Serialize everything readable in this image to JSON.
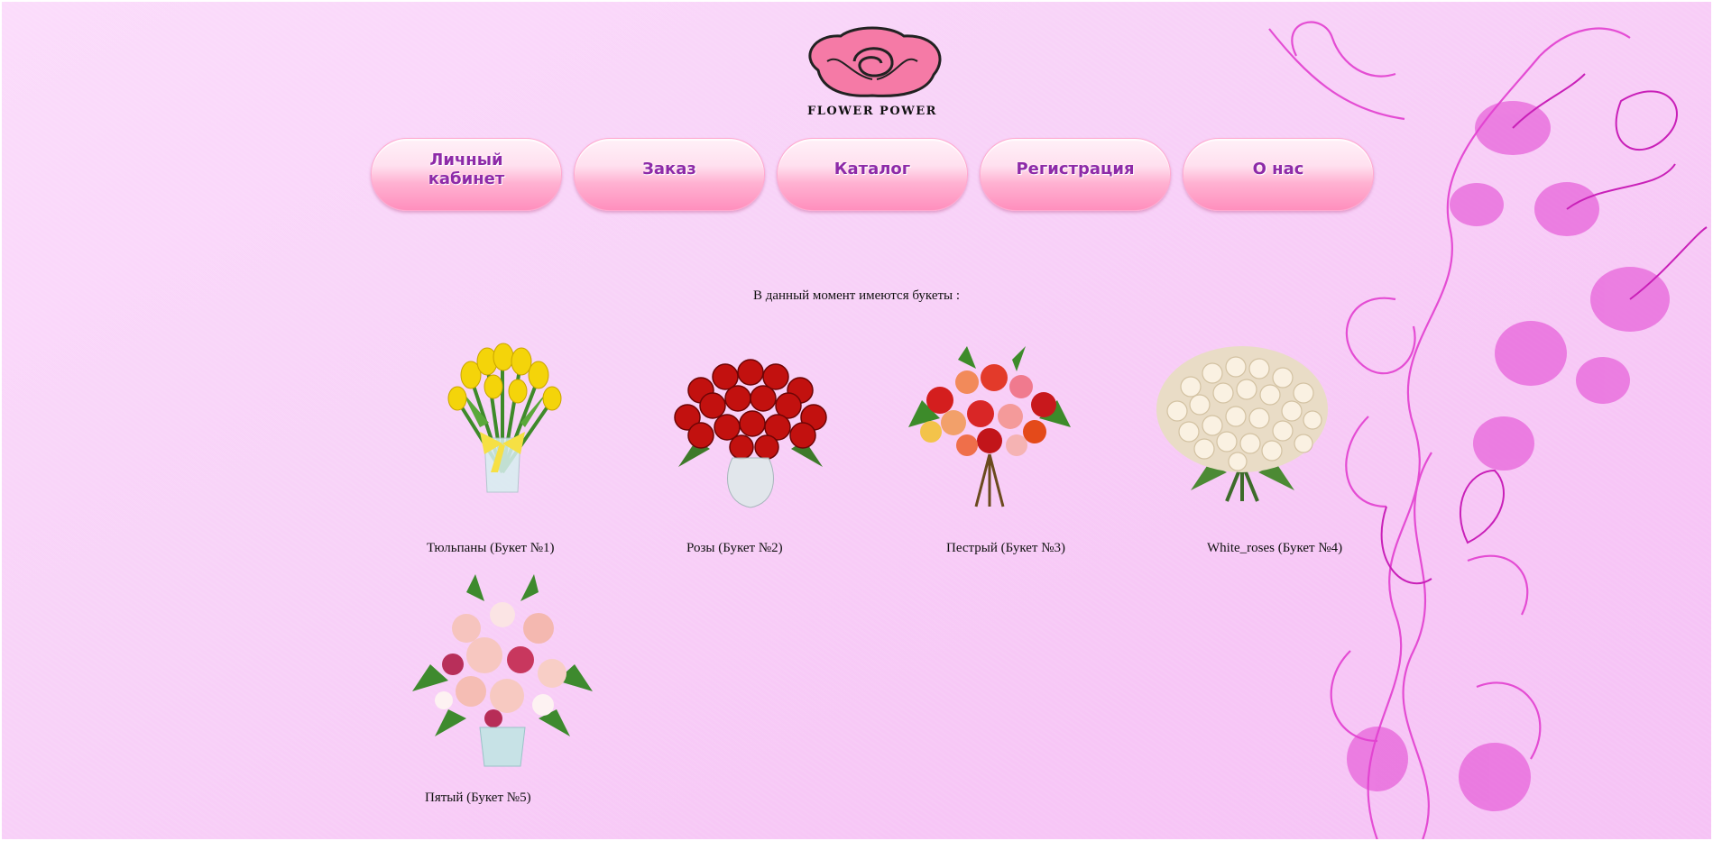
{
  "logo": {
    "text": "FLOWER POWER"
  },
  "nav": [
    {
      "label_line1": "Личный",
      "label_line2": "кабинет"
    },
    {
      "label_line1": "Заказ",
      "label_line2": ""
    },
    {
      "label_line1": "Каталог",
      "label_line2": ""
    },
    {
      "label_line1": "Регистрация",
      "label_line2": ""
    },
    {
      "label_line1": "О нас",
      "label_line2": ""
    }
  ],
  "intro": "В данный момент имеются букеты :",
  "bouquets": [
    {
      "caption": "Тюльпаны (Букет №1)",
      "icon": "yellow-tulip-bouquet"
    },
    {
      "caption": "Розы (Букет №2)",
      "icon": "red-rose-bouquet"
    },
    {
      "caption": "Пестрый (Букет №3)",
      "icon": "mixed-bouquet"
    },
    {
      "caption": "White_roses (Букет №4)",
      "icon": "white-rose-bouquet"
    },
    {
      "caption": "Пятый (Букет №5)",
      "icon": "pink-rose-bouquet"
    }
  ],
  "colors": {
    "background": "#f8d2f8",
    "button_text": "#8e2aa8",
    "button_pink": "#ff8fbd",
    "floral_magenta": "#e23fd0",
    "logo_rose": "#f57aa6"
  }
}
